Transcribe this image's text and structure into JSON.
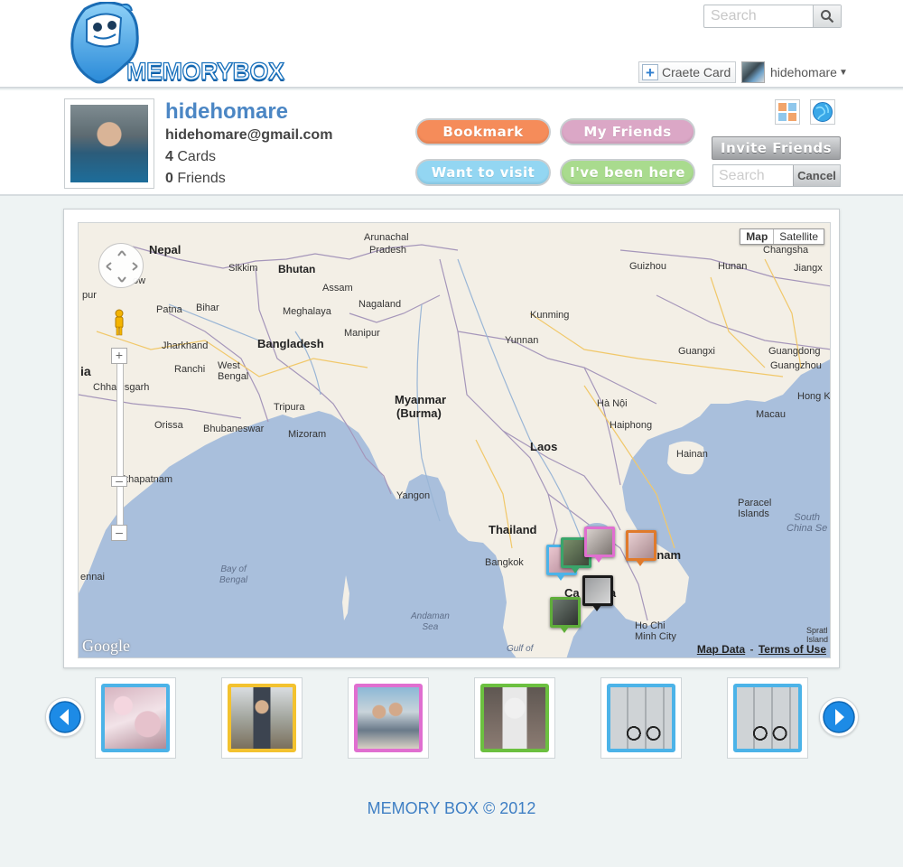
{
  "header": {
    "logo_text": "MEMORYBOX",
    "search_placeholder": "Search",
    "create_card_label": "Craete Card",
    "username": "hidehomare"
  },
  "profile": {
    "name": "hidehomare",
    "email": "hidehomare@gmail.com",
    "cards_count": "4",
    "cards_label": "Cards",
    "friends_count": "0",
    "friends_label": "Friends"
  },
  "actions": {
    "bookmark": "Bookmark",
    "my_friends": "My Friends",
    "want_to_visit": "Want to visit",
    "been_here": "I've been here",
    "invite_friends": "Invite Friends",
    "friend_search_placeholder": "Search",
    "cancel": "Cancel"
  },
  "colors": {
    "bookmark": "#f58c5a",
    "my_friends": "#d9a4c3",
    "want_to_visit": "#8fd4f1",
    "been_here": "#a6da8b",
    "accent": "#4b86c4"
  },
  "map": {
    "type_map": "Map",
    "type_satellite": "Satellite",
    "map_data": "Map Data",
    "separator": "-",
    "terms": "Terms of Use",
    "google": "Google",
    "labels": {
      "nepal": "Nepal",
      "sikkim": "Sikkim",
      "bhutan": "Bhutan",
      "arunachal": "Arunachal",
      "pradesh": "Pradesh",
      "assam": "Assam",
      "nagaland": "Nagaland",
      "meghalaya": "Meghalaya",
      "manipur": "Manipur",
      "bihar": "Bihar",
      "patna": "Patna",
      "jharkhand": "Jharkhand",
      "ranchi": "Ranchi",
      "west_bengal": "West\nBengal",
      "chhattisgarh": "Chhattisgarh",
      "orissa": "Orissa",
      "bhubaneswar": "Bhubaneswar",
      "bangladesh": "Bangladesh",
      "tripura": "Tripura",
      "mizoram": "Mizoram",
      "myanmar": "Myanmar",
      "burma": "(Burma)",
      "yangon": "Yangon",
      "thailand": "Thailand",
      "bangkok": "Bangkok",
      "laos": "Laos",
      "kunming": "Kunming",
      "yunnan": "Yunnan",
      "guizhou": "Guizhou",
      "hunan": "Hunan",
      "jiangx": "Jiangx",
      "changsha": "Changsha",
      "guangxi": "Guangxi",
      "guangdong": "Guangdong",
      "guangzhou": "Guangzhou",
      "hong": "Hong K",
      "macau": "Macau",
      "ha_noi": "Hà Nội",
      "haiphong": "Haiphong",
      "hainan": "Hainan",
      "paracel": "Paracel\nIslands",
      "south_china": "South\nChina Se",
      "vietnam": "tnam",
      "cambodia": "Ca      dia",
      "ho_chi_minh": "Ho Chi\nMinh City",
      "sakhapatnam": "sakhapatnam",
      "chennai": "ennai",
      "bay_of_bengal": "Bay of\nBengal",
      "andaman_sea": "Andaman\nSea",
      "gulf_of": "Gulf of",
      "spratly": "Spratl\nIsland",
      "ia": "ia",
      "ow": "ow",
      "pur": "pur"
    }
  },
  "thumbnails": [
    {
      "name": "cherry-blossom-photo",
      "border": "#4cb3e8"
    },
    {
      "name": "man-hillside-photo",
      "border": "#f3c22f"
    },
    {
      "name": "couple-photo",
      "border": "#e06fd0"
    },
    {
      "name": "astronaut-photo",
      "border": "#6cc040"
    },
    {
      "name": "bicycle-photo",
      "border": "#4cb3e8"
    },
    {
      "name": "bicycle-photo-2",
      "border": "#4cb3e8"
    }
  ],
  "footer": {
    "copyright": "MEMORY BOX © 2012"
  }
}
